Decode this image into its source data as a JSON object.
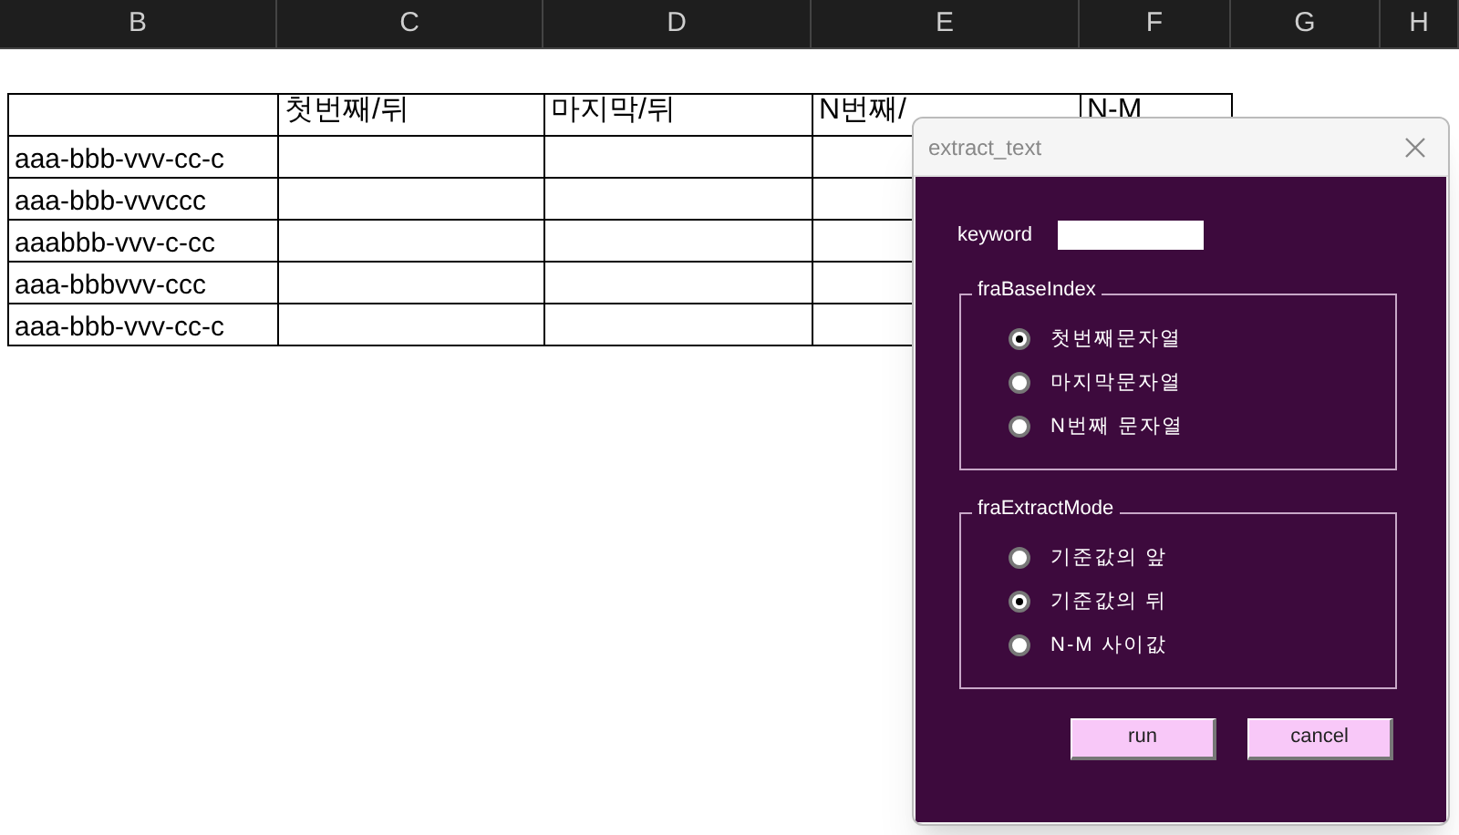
{
  "column_headers": [
    "B",
    "C",
    "D",
    "E",
    "F",
    "G",
    "H"
  ],
  "table": {
    "columns": [
      "",
      "첫번째/뒤",
      "마지막/뒤",
      "N번째/",
      "N-M"
    ],
    "rows": [
      [
        "aaa-bbb-vvv-cc-c"
      ],
      [
        "aaa-bbb-vvvccc"
      ],
      [
        "aaabbb-vvv-c-cc"
      ],
      [
        "aaa-bbbvvv-ccc"
      ],
      [
        "aaa-bbb-vvv-cc-c"
      ]
    ]
  },
  "dialog": {
    "title": "extract_text",
    "keyword": {
      "label": "keyword"
    },
    "frames": [
      {
        "title": "fraBaseIndex",
        "options": [
          {
            "label": "첫번째문자열",
            "selected": true
          },
          {
            "label": "마지막문자열",
            "selected": false
          },
          {
            "label": "N번째 문자열",
            "selected": false
          }
        ]
      },
      {
        "title": "fraExtractMode",
        "options": [
          {
            "label": "기준값의 앞",
            "selected": false
          },
          {
            "label": "기준값의 뒤",
            "selected": true
          },
          {
            "label": "N-M 사이값",
            "selected": false
          }
        ]
      }
    ],
    "buttons": [
      "run",
      "cancel"
    ]
  }
}
